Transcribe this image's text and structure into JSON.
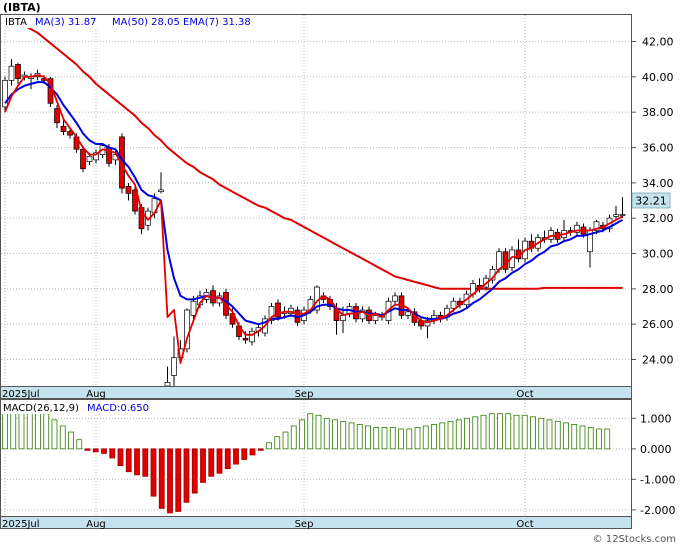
{
  "title": "(IBTA)",
  "legend": {
    "ticker": "IBTA",
    "ma3": "MA(3)  31.87",
    "ma50": "MA(50)  28.05",
    "ema7": "EMA(7)  31.38"
  },
  "price_tag": "32.21",
  "macd_legend": {
    "params": "MACD(26,12,9)",
    "value": "MACD:0.650"
  },
  "watermark": "© 12Stocks.com",
  "colors": {
    "up": "#ffffff",
    "down": "#e00000",
    "ma3": "#0000dd",
    "ma50": "#e00000",
    "axis_bar": "#c5e3ee",
    "macd_bar": "#2e7d00",
    "macd_neg": "#e00000",
    "price_tag": "#c5e3ee"
  },
  "chart_data": [
    {
      "type": "candlestick",
      "ylim": [
        22.5,
        43.5
      ],
      "yticks": [
        "42.00",
        "40.00",
        "38.00",
        "36.00",
        "34.00",
        "32.00",
        "30.00",
        "28.00",
        "26.00",
        "24.00"
      ],
      "ytick_values": [
        42,
        40,
        38,
        36,
        34,
        32,
        30,
        28,
        26,
        24
      ],
      "xlabels": [
        {
          "text": "2025Jul",
          "index": 0
        },
        {
          "text": "Aug",
          "index": 14
        },
        {
          "text": "Sep",
          "index": 46
        },
        {
          "text": "Oct",
          "index": 80
        }
      ],
      "candles": [
        [
          38.3,
          39.8,
          38.0,
          40.0
        ],
        [
          39.8,
          40.6,
          39.5,
          41.0
        ],
        [
          40.7,
          39.9,
          39.6,
          40.8
        ],
        [
          40.0,
          40.1,
          39.8,
          40.3
        ],
        [
          39.9,
          40.0,
          39.3,
          40.2
        ],
        [
          40.0,
          40.2,
          39.8,
          40.4
        ],
        [
          39.9,
          39.8,
          39.6,
          40.1
        ],
        [
          39.9,
          38.5,
          38.3,
          40.0
        ],
        [
          38.2,
          37.4,
          37.1,
          38.4
        ],
        [
          37.2,
          36.9,
          36.7,
          37.6
        ],
        [
          36.9,
          36.7,
          36.5,
          37.1
        ],
        [
          36.6,
          35.9,
          35.7,
          36.8
        ],
        [
          35.9,
          34.8,
          34.6,
          36.1
        ],
        [
          35.2,
          35.5,
          35.0,
          35.7
        ],
        [
          35.3,
          35.7,
          35.1,
          35.9
        ],
        [
          35.6,
          36.1,
          35.4,
          36.2
        ],
        [
          36.0,
          35.1,
          34.9,
          36.2
        ],
        [
          35.3,
          35.6,
          35.0,
          35.8
        ],
        [
          36.6,
          33.7,
          33.4,
          36.8
        ],
        [
          33.8,
          33.4,
          33.0,
          34.0
        ],
        [
          33.6,
          32.4,
          32.2,
          33.8
        ],
        [
          32.6,
          31.4,
          31.1,
          32.8
        ],
        [
          31.6,
          32.4,
          31.3,
          32.6
        ],
        [
          32.3,
          33.1,
          32.0,
          33.4
        ],
        [
          33.5,
          33.6,
          33.4,
          34.6
        ],
        [
          22.5,
          22.7,
          22.4,
          23.6
        ],
        [
          23.1,
          24.1,
          22.5,
          25.3
        ],
        [
          24.1,
          24.6,
          23.9,
          25.1
        ],
        [
          24.6,
          26.8,
          24.4,
          26.9
        ],
        [
          26.5,
          27.3,
          26.3,
          27.6
        ],
        [
          27.1,
          27.6,
          26.9,
          27.9
        ],
        [
          27.4,
          27.8,
          27.2,
          28.0
        ],
        [
          27.9,
          27.2,
          27.0,
          28.2
        ],
        [
          27.2,
          27.6,
          27.0,
          27.8
        ],
        [
          27.8,
          26.5,
          26.3,
          28.0
        ],
        [
          26.6,
          26.0,
          25.8,
          26.9
        ],
        [
          25.9,
          25.3,
          25.1,
          26.1
        ],
        [
          25.2,
          25.1,
          24.9,
          25.6
        ],
        [
          25.0,
          25.6,
          24.8,
          25.8
        ],
        [
          25.6,
          25.8,
          25.3,
          26.0
        ],
        [
          25.5,
          26.3,
          25.3,
          26.5
        ],
        [
          26.2,
          27.0,
          26.0,
          27.2
        ],
        [
          27.2,
          26.4,
          26.2,
          27.4
        ],
        [
          26.6,
          26.7,
          26.3,
          27.0
        ],
        [
          26.6,
          26.9,
          26.4,
          27.1
        ],
        [
          26.8,
          26.1,
          25.9,
          27.0
        ],
        [
          26.2,
          26.8,
          26.0,
          27.0
        ],
        [
          26.8,
          27.4,
          26.6,
          27.6
        ],
        [
          26.8,
          28.1,
          26.6,
          28.2
        ],
        [
          27.6,
          27.4,
          27.2,
          27.8
        ],
        [
          27.4,
          27.0,
          26.8,
          27.6
        ],
        [
          26.9,
          26.2,
          25.4,
          27.2
        ],
        [
          26.2,
          26.5,
          25.5,
          27.0
        ],
        [
          26.6,
          27.0,
          26.4,
          27.2
        ],
        [
          27.0,
          26.3,
          26.1,
          27.2
        ],
        [
          26.3,
          26.8,
          26.1,
          27.0
        ],
        [
          26.8,
          26.2,
          26.0,
          27.0
        ],
        [
          26.2,
          26.5,
          26.0,
          26.7
        ],
        [
          26.5,
          26.4,
          26.2,
          26.7
        ],
        [
          26.2,
          27.3,
          26.0,
          27.5
        ],
        [
          27.3,
          27.6,
          27.1,
          27.8
        ],
        [
          27.6,
          26.5,
          26.3,
          27.8
        ],
        [
          26.5,
          26.7,
          26.3,
          26.9
        ],
        [
          26.7,
          26.1,
          25.9,
          26.9
        ],
        [
          26.2,
          25.9,
          25.7,
          26.4
        ],
        [
          25.9,
          26.2,
          25.2,
          26.4
        ],
        [
          26.2,
          26.5,
          26.0,
          26.8
        ],
        [
          26.5,
          26.3,
          26.1,
          26.7
        ],
        [
          26.4,
          26.9,
          26.2,
          27.1
        ],
        [
          26.9,
          27.3,
          26.7,
          27.5
        ],
        [
          27.3,
          27.1,
          26.9,
          27.5
        ],
        [
          27.1,
          27.7,
          26.9,
          27.9
        ],
        [
          27.7,
          28.3,
          27.5,
          28.5
        ],
        [
          28.2,
          28.0,
          27.8,
          28.6
        ],
        [
          28.1,
          28.6,
          27.9,
          28.8
        ],
        [
          28.5,
          29.1,
          28.3,
          29.3
        ],
        [
          29.1,
          30.1,
          28.9,
          30.3
        ],
        [
          30.1,
          29.1,
          28.9,
          30.3
        ],
        [
          29.2,
          30.2,
          29.0,
          30.4
        ],
        [
          30.2,
          29.7,
          29.5,
          30.8
        ],
        [
          29.7,
          30.7,
          29.5,
          30.9
        ],
        [
          30.7,
          30.3,
          30.1,
          31.1
        ],
        [
          30.3,
          30.9,
          30.1,
          31.1
        ],
        [
          30.9,
          30.8,
          30.6,
          31.3
        ],
        [
          30.8,
          31.3,
          30.6,
          31.5
        ],
        [
          31.2,
          30.8,
          30.6,
          31.4
        ],
        [
          30.9,
          31.3,
          30.7,
          31.9
        ],
        [
          31.3,
          31.2,
          31.0,
          31.5
        ],
        [
          31.2,
          31.6,
          31.0,
          31.8
        ],
        [
          31.5,
          31.1,
          30.9,
          31.7
        ],
        [
          30.1,
          31.3,
          29.2,
          31.5
        ],
        [
          31.3,
          31.8,
          31.1,
          31.9
        ],
        [
          31.6,
          31.4,
          31.2,
          31.8
        ],
        [
          31.4,
          32.0,
          31.2,
          32.2
        ],
        [
          32.1,
          32.2,
          31.9,
          32.7
        ],
        [
          32.2,
          32.2,
          32.0,
          33.2
        ]
      ],
      "ma3": [
        38.0,
        38.9,
        39.5,
        40.0,
        40.0,
        40.1,
        40.0,
        39.6,
        38.6,
        37.6,
        37.1,
        36.6,
        36.0,
        35.6,
        35.6,
        35.9,
        35.8,
        35.7,
        35.0,
        34.4,
        33.9,
        32.4,
        31.9,
        32.3,
        33.0,
        26.4,
        26.8,
        23.8,
        25.2,
        26.2,
        27.2,
        27.6,
        27.5,
        27.5,
        27.1,
        26.7,
        25.9,
        25.4,
        25.4,
        25.6,
        25.9,
        26.4,
        26.6,
        26.7,
        26.7,
        26.6,
        26.6,
        26.8,
        27.3,
        27.6,
        27.4,
        26.9,
        26.5,
        26.6,
        26.6,
        26.7,
        26.5,
        26.6,
        26.4,
        26.8,
        27.1,
        27.1,
        26.9,
        26.5,
        26.2,
        26.1,
        26.2,
        26.3,
        26.5,
        26.8,
        27.1,
        27.4,
        27.7,
        28.0,
        28.3,
        28.6,
        29.1,
        29.4,
        29.8,
        29.8,
        30.2,
        30.3,
        30.6,
        30.8,
        31.0,
        31.0,
        31.1,
        31.2,
        31.3,
        31.3,
        31.3,
        31.4,
        31.5,
        31.7,
        31.9,
        32.1
      ],
      "ema7": [
        38.5,
        39.0,
        39.3,
        39.5,
        39.6,
        39.7,
        39.7,
        39.4,
        39.0,
        38.4,
        37.9,
        37.4,
        36.8,
        36.4,
        36.2,
        36.2,
        36.0,
        35.9,
        35.3,
        34.9,
        34.3,
        33.6,
        33.3,
        33.2,
        33.0,
        30.2,
        28.6,
        27.6,
        27.4,
        27.4,
        27.5,
        27.6,
        27.5,
        27.5,
        27.3,
        27.0,
        26.6,
        26.2,
        26.1,
        26.0,
        26.1,
        26.3,
        26.3,
        26.4,
        26.5,
        26.4,
        26.5,
        26.7,
        27.0,
        27.1,
        27.1,
        26.9,
        26.8,
        26.8,
        26.7,
        26.7,
        26.6,
        26.6,
        26.5,
        26.7,
        26.9,
        26.8,
        26.8,
        26.6,
        26.4,
        26.3,
        26.3,
        26.3,
        26.4,
        26.6,
        26.7,
        26.9,
        27.2,
        27.4,
        27.7,
        28.0,
        28.4,
        28.6,
        28.9,
        29.1,
        29.4,
        29.6,
        29.9,
        30.1,
        30.4,
        30.5,
        30.7,
        30.8,
        31.0,
        31.0,
        31.1,
        31.2,
        31.3,
        31.5,
        31.7,
        31.9
      ],
      "ma50": [
        43.5,
        43.3,
        43.1,
        42.9,
        42.7,
        42.5,
        42.2,
        41.9,
        41.6,
        41.3,
        41.0,
        40.7,
        40.3,
        40.0,
        39.6,
        39.3,
        39.0,
        38.7,
        38.4,
        38.1,
        37.8,
        37.4,
        37.1,
        36.7,
        36.4,
        36.0,
        35.7,
        35.4,
        35.1,
        34.9,
        34.6,
        34.4,
        34.2,
        33.9,
        33.7,
        33.5,
        33.3,
        33.1,
        32.9,
        32.7,
        32.6,
        32.4,
        32.2,
        32.0,
        31.9,
        31.7,
        31.5,
        31.3,
        31.1,
        30.9,
        30.7,
        30.5,
        30.3,
        30.1,
        29.9,
        29.7,
        29.5,
        29.3,
        29.1,
        28.9,
        28.7,
        28.6,
        28.5,
        28.4,
        28.3,
        28.2,
        28.1,
        28.0,
        28.0,
        28.0,
        28.0,
        28.0,
        28.0,
        28.0,
        28.0,
        28.0,
        28.0,
        28.0,
        28.0,
        28.0,
        28.0,
        28.0,
        28.0,
        28.05,
        28.05,
        28.05,
        28.05,
        28.05,
        28.05,
        28.05,
        28.05,
        28.05,
        28.05,
        28.05,
        28.05,
        28.05
      ]
    },
    {
      "type": "bar",
      "ylim": [
        -2.2,
        1.6
      ],
      "yticks": [
        "1.000",
        "0.000",
        "-1.000",
        "-2.000"
      ],
      "ytick_values": [
        1,
        0,
        -1,
        -2
      ],
      "values": [
        1.35,
        1.55,
        1.55,
        1.55,
        1.45,
        1.15,
        0.95,
        0.75,
        0.55,
        0.3,
        -0.05,
        -0.1,
        -0.15,
        -0.3,
        -0.55,
        -0.75,
        -0.85,
        -0.9,
        -1.55,
        -1.95,
        -2.1,
        -2.05,
        -1.75,
        -1.45,
        -1.1,
        -0.9,
        -0.8,
        -0.65,
        -0.5,
        -0.35,
        -0.2,
        -0.05,
        0.2,
        0.4,
        0.55,
        0.75,
        0.95,
        1.15,
        1.1,
        1.0,
        0.95,
        0.9,
        0.85,
        0.8,
        0.75,
        0.7,
        0.7,
        0.7,
        0.65,
        0.65,
        0.7,
        0.75,
        0.8,
        0.85,
        0.9,
        0.95,
        1.0,
        1.05,
        1.1,
        1.15,
        1.15,
        1.15,
        1.1,
        1.1,
        1.05,
        1.0,
        0.95,
        0.9,
        0.85,
        0.8,
        0.75,
        0.7,
        0.65,
        0.65
      ]
    }
  ]
}
